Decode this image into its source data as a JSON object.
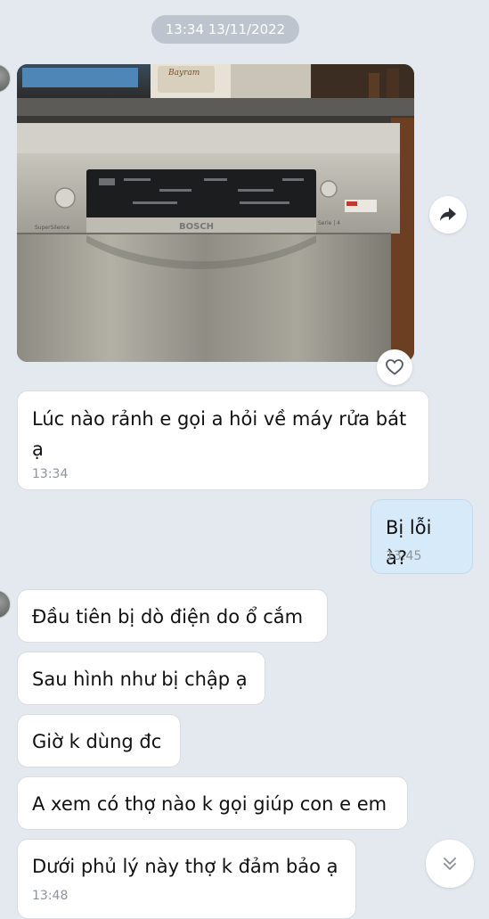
{
  "date_separator": "13:34 13/11/2022",
  "photo": {
    "brand": "BOSCH",
    "sticker_text": "Bayram",
    "panel_label": "SuperSilence",
    "series_label": "Serie | 4"
  },
  "icons": {
    "share": "share-arrow-icon",
    "like": "heart-icon",
    "scroll_down": "double-chevron-down-icon"
  },
  "messages": [
    {
      "direction": "in",
      "text": "Lúc nào rảnh e gọi a hỏi về máy rửa bát ạ",
      "time": "13:34"
    },
    {
      "direction": "out",
      "text": "Bị lỗi à?",
      "time": "13:45"
    },
    {
      "direction": "in",
      "text": "Đầu tiên bị dò điện do ổ cắm"
    },
    {
      "direction": "in",
      "text": "Sau hình như bị chập ạ"
    },
    {
      "direction": "in",
      "text": "Giờ k dùng đc"
    },
    {
      "direction": "in",
      "text": "A xem có thợ nào k gọi giúp con e em"
    },
    {
      "direction": "in",
      "text": "Dưới phủ lý này thợ k đảm bảo ạ",
      "time": "13:48"
    }
  ]
}
